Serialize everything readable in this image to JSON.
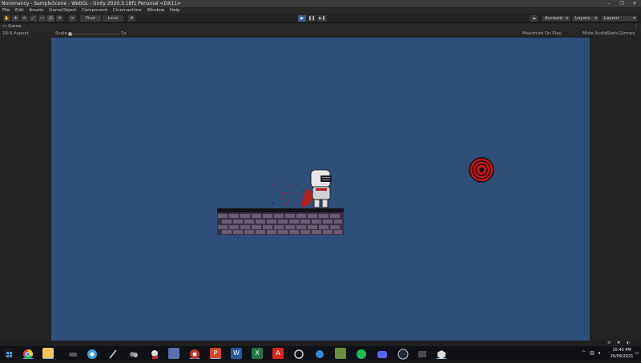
{
  "window": {
    "title": "Noromancy - SampleScene - WebGL - Unity 2020.3.18f1 Personal <DX11>",
    "minimize": "–",
    "maximize": "❐",
    "close": "✕"
  },
  "menu": [
    "File",
    "Edit",
    "Assets",
    "GameObject",
    "Component",
    "Cinemachine",
    "Window",
    "Help"
  ],
  "toolbar": {
    "pivot": "Pivot",
    "local": "Local",
    "account": "Account",
    "layers": "Layers",
    "layout": "Layout",
    "play": "▶",
    "pause": "❚❚",
    "step": "▶❚"
  },
  "game_tab": {
    "label": "Game",
    "aspect": "16:9 Aspect",
    "scale_label": "Scale",
    "scale_value": "1x",
    "maximize_on_play": "Maximize On Play",
    "mute_audio": "Mute Audio",
    "stats": "Stats",
    "gizmos": "Gizmos"
  },
  "colors": {
    "game_background": "#2f4e78",
    "target_red": "#d01010",
    "cape_red": "#b02020"
  },
  "taskbar": {
    "time": "10:40 PM",
    "date": "26/09/2021",
    "apps": [
      "start-icon",
      "chrome-icon",
      "file-explorer-icon",
      "gamepad-icon",
      "steam-like-icon",
      "pen-icon",
      "paint-icon",
      "document-icon",
      "chrome-canary-icon",
      "powerpoint-icon",
      "word-icon",
      "excel-icon",
      "acrobat-icon",
      "headset-icon",
      "unity-hub-icon",
      "minecraft-icon",
      "spotify-icon",
      "discord-icon",
      "steam-icon",
      "terminal-icon",
      "unity-icon"
    ]
  }
}
